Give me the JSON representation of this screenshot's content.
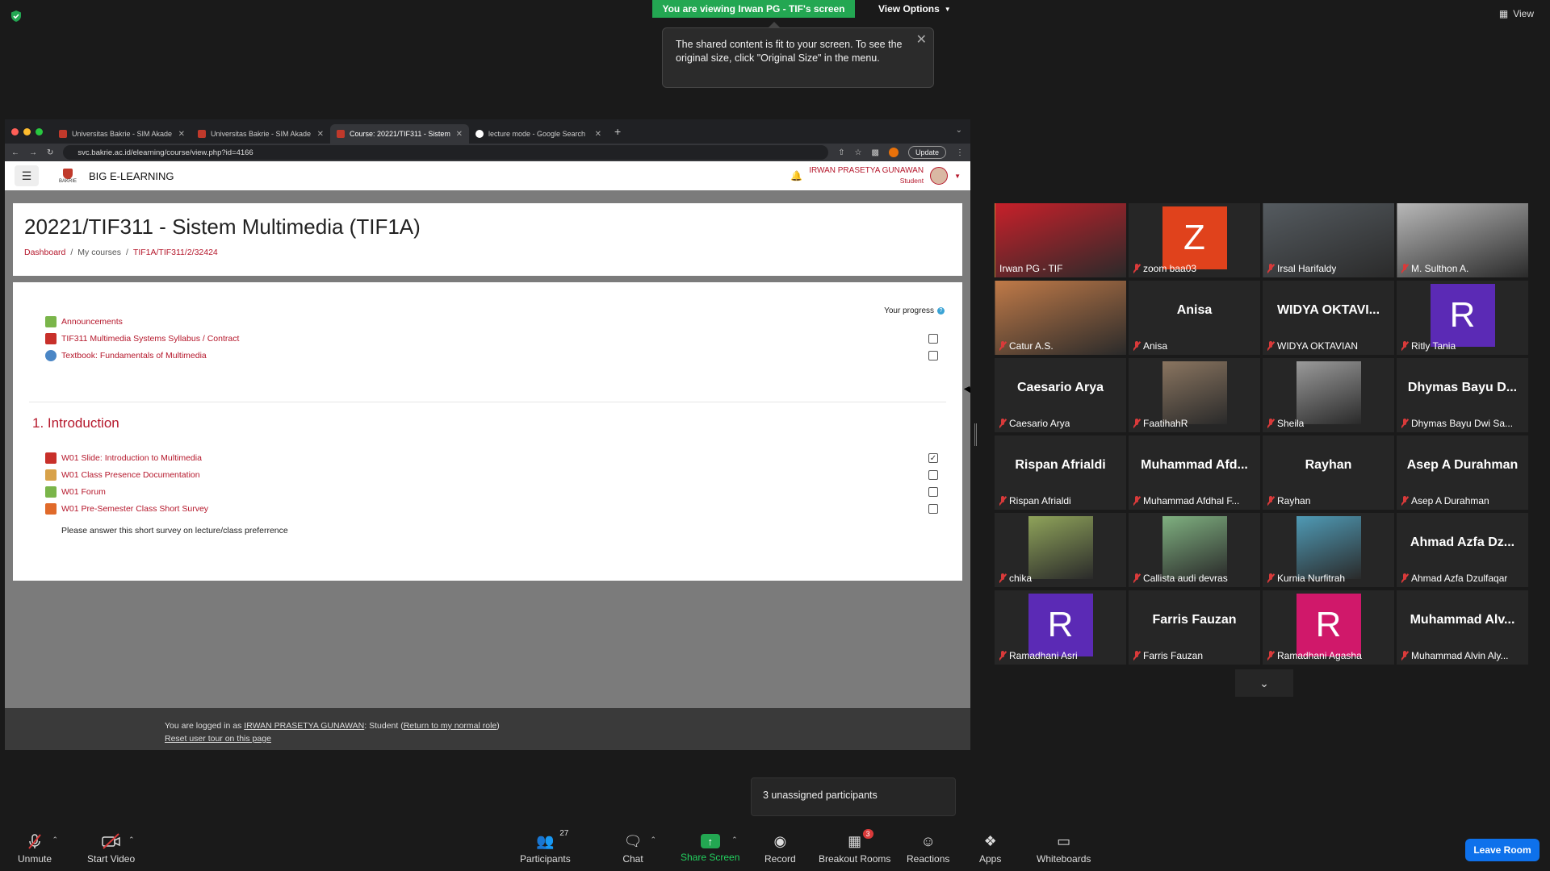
{
  "zoom": {
    "viewing_banner": "You are viewing Irwan PG - TIF's screen",
    "view_options": "View Options",
    "top_view": "View",
    "tooltip_text": "The shared content is fit to your screen. To see the original size, click \"Original Size\" in the menu."
  },
  "browser": {
    "tabs": [
      {
        "title": "Universitas Bakrie - SIM Akade"
      },
      {
        "title": "Universitas Bakrie - SIM Akade"
      },
      {
        "title": "Course: 20221/TIF311 - Sistem"
      },
      {
        "title": "lecture mode - Google Search"
      }
    ],
    "url": "svc.bakrie.ac.id/elearning/course/view.php?id=4166",
    "update_label": "Update"
  },
  "moodle": {
    "site_name": "BIG E-LEARNING",
    "logo_text": "BAKRIE",
    "user_name": "IRWAN PRASETYA GUNAWAN",
    "user_role": "Student",
    "course_title": "20221/TIF311 - Sistem Multimedia (TIF1A)",
    "breadcrumb": [
      "Dashboard",
      "My courses",
      "TIF1A/TIF311/2/32424"
    ],
    "your_progress": "Your progress",
    "general_activities": [
      {
        "label": "Announcements",
        "icon": "forum-icon",
        "checkbox": null
      },
      {
        "label": "TIF311 Multimedia Systems Syllabus / Contract",
        "icon": "pdf-icon",
        "checkbox": false
      },
      {
        "label": "Textbook: Fundamentals of Multimedia",
        "icon": "url-icon",
        "checkbox": false
      }
    ],
    "section_title": "1. Introduction",
    "section_activities": [
      {
        "label": "W01 Slide: Introduction to Multimedia",
        "icon": "pdf-icon",
        "checkbox": true
      },
      {
        "label": "W01 Class Presence Documentation",
        "icon": "assignment-icon",
        "checkbox": false
      },
      {
        "label": "W01 Forum",
        "icon": "forum-icon",
        "checkbox": false
      },
      {
        "label": "W01 Pre-Semester Class Short Survey",
        "icon": "survey-icon",
        "checkbox": false
      }
    ],
    "survey_description": "Please answer this short survey on lecture/class preferrence",
    "footer": {
      "logged_prefix": "You are logged in as",
      "logged_user": "IRWAN PRASETYA GUNAWAN",
      "logged_role": "Student",
      "return_link": "Return to my normal role",
      "reset_tour": "Reset user tour on this page"
    }
  },
  "gallery": [
    {
      "name": "Irwan PG - TIF",
      "type": "photo",
      "color": "#c8202a",
      "active": true,
      "muted": false
    },
    {
      "name": "zoom baa03",
      "type": "letter",
      "letter": "Z",
      "color": "#e0421c",
      "muted": true
    },
    {
      "name": "Irsal Harifaldy",
      "type": "photo",
      "color": "#555b60",
      "muted": true
    },
    {
      "name": "M. Sulthon A.",
      "type": "photo",
      "color": "#b8b8b8",
      "muted": true
    },
    {
      "name": "Catur A.S.",
      "type": "photo",
      "color": "#c07a48",
      "muted": true
    },
    {
      "name": "Anisa",
      "type": "text",
      "big": "Anisa",
      "muted": true
    },
    {
      "name": "WIDYA OKTAVIAN",
      "type": "text",
      "big": "WIDYA OKTAVI...",
      "muted": true
    },
    {
      "name": "Ritly Tania",
      "type": "letter",
      "letter": "R",
      "color": "#5b2ab5",
      "muted": true
    },
    {
      "name": "Caesario Arya",
      "type": "text",
      "big": "Caesario Arya",
      "muted": true
    },
    {
      "name": "FaatihahR",
      "type": "photo",
      "color": "#8a7560",
      "muted": true
    },
    {
      "name": "Sheila",
      "type": "photo",
      "color": "#9a9a9a",
      "muted": true
    },
    {
      "name": "Dhymas Bayu Dwi Sa...",
      "type": "text",
      "big": "Dhymas Bayu D...",
      "muted": true
    },
    {
      "name": "Rispan Afrialdi",
      "type": "text",
      "big": "Rispan Afrialdi",
      "muted": true
    },
    {
      "name": "Muhammad Afdhal F...",
      "type": "text",
      "big": "Muhammad Afd...",
      "muted": true
    },
    {
      "name": "Rayhan",
      "type": "text",
      "big": "Rayhan",
      "muted": true
    },
    {
      "name": "Asep A Durahman",
      "type": "text",
      "big": "Asep A Durahman",
      "muted": true
    },
    {
      "name": "chika",
      "type": "photo",
      "color": "#8fa35a",
      "muted": true
    },
    {
      "name": "Callista audi devras",
      "type": "photo",
      "color": "#7fb080",
      "muted": true
    },
    {
      "name": "Kurnia Nurfitrah",
      "type": "photo",
      "color": "#4f9ab5",
      "muted": true
    },
    {
      "name": "Ahmad Azfa Dzulfaqar",
      "type": "text",
      "big": "Ahmad Azfa Dz...",
      "muted": true
    },
    {
      "name": "Ramadhani Asri",
      "type": "letter",
      "letter": "R",
      "color": "#5b2ab5",
      "muted": true
    },
    {
      "name": "Farris Fauzan",
      "type": "text",
      "big": "Farris Fauzan",
      "muted": true
    },
    {
      "name": "Ramadhani Agasha",
      "type": "letter",
      "letter": "R",
      "color": "#d0186a",
      "muted": true
    },
    {
      "name": "Muhammad Alvin Aly...",
      "type": "text",
      "big": "Muhammad Alv...",
      "muted": true
    }
  ],
  "unassigned": "3 unassigned participants",
  "toolbar": {
    "unmute": "Unmute",
    "start_video": "Start Video",
    "participants": "Participants",
    "participants_count": "27",
    "chat": "Chat",
    "share_screen": "Share Screen",
    "record": "Record",
    "breakout_rooms": "Breakout Rooms",
    "breakout_badge": "3",
    "reactions": "Reactions",
    "apps": "Apps",
    "whiteboards": "Whiteboards",
    "leave_room": "Leave Room"
  }
}
